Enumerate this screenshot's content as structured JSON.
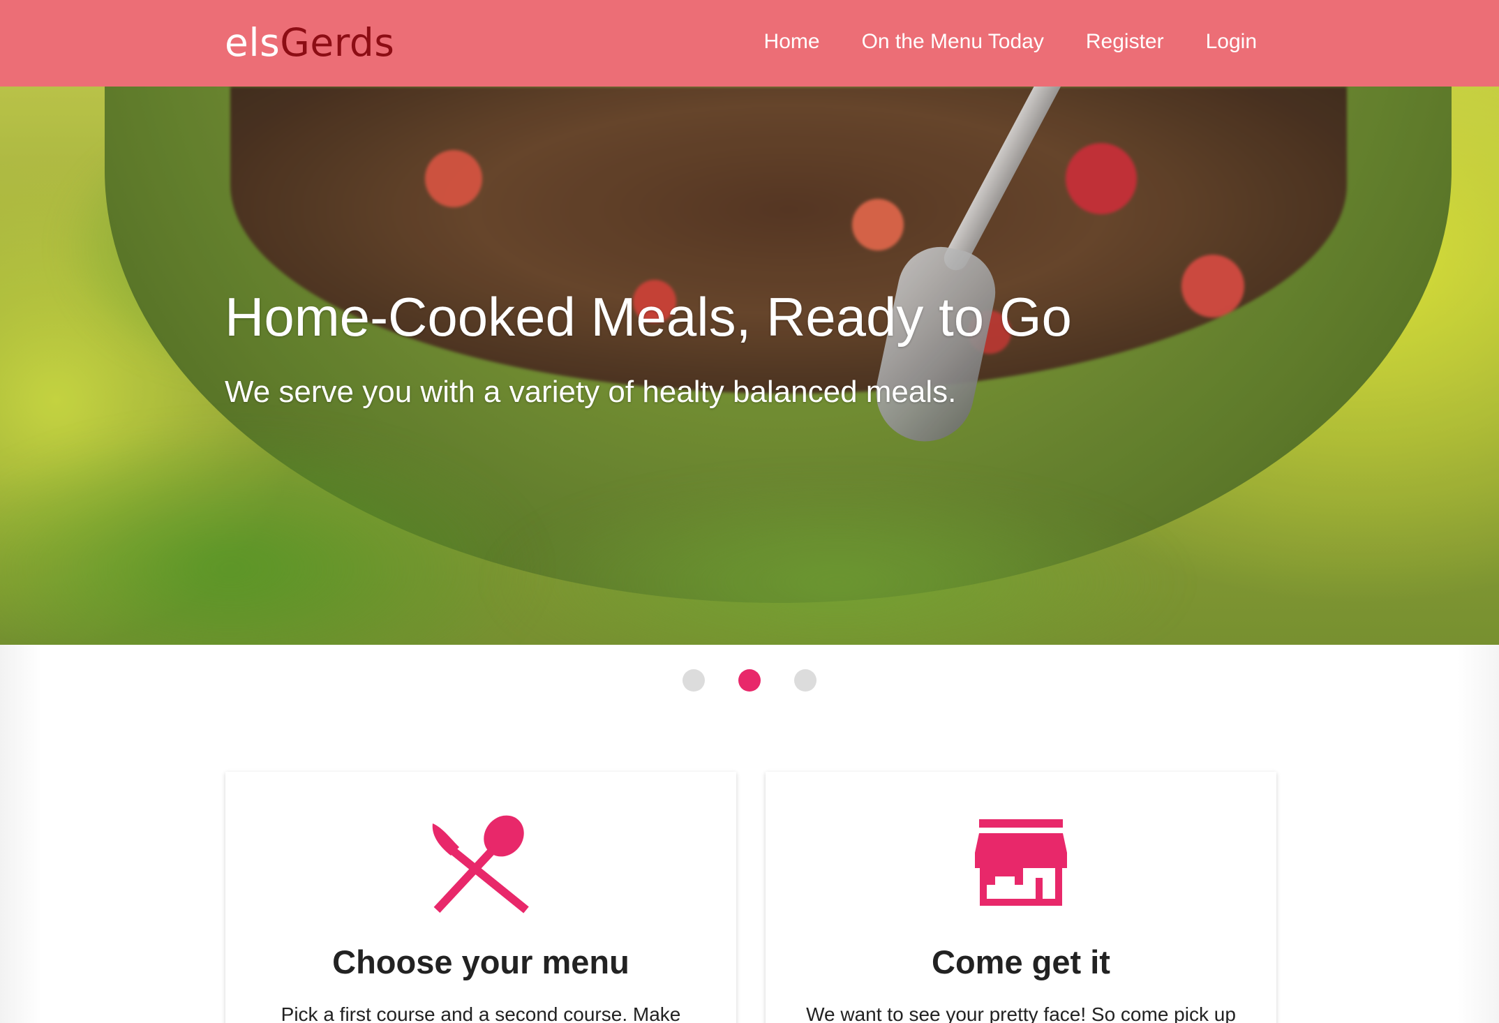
{
  "navbar": {
    "brand_part1": "els",
    "brand_part2": "Gerds",
    "links": [
      {
        "label": "Home"
      },
      {
        "label": "On the Menu Today"
      },
      {
        "label": "Register"
      },
      {
        "label": "Login"
      }
    ]
  },
  "hero": {
    "title": "Home-Cooked Meals, Ready to Go",
    "subtitle": "We serve you with a variety of healty balanced meals."
  },
  "carousel": {
    "slide_count": 3,
    "active_index": 1
  },
  "cards": [
    {
      "icon": "cutlery-icon",
      "title": "Choose your menu",
      "text": "Pick a first course and a second course. Make"
    },
    {
      "icon": "store-icon",
      "title": "Come get it",
      "text": "We want to see your pretty face! So come pick up"
    }
  ],
  "colors": {
    "navbar_bg": "#ec6e76",
    "brand_accent": "#8c0d14",
    "primary_pink": "#e8286a",
    "dot_inactive": "#dcdcdc"
  }
}
